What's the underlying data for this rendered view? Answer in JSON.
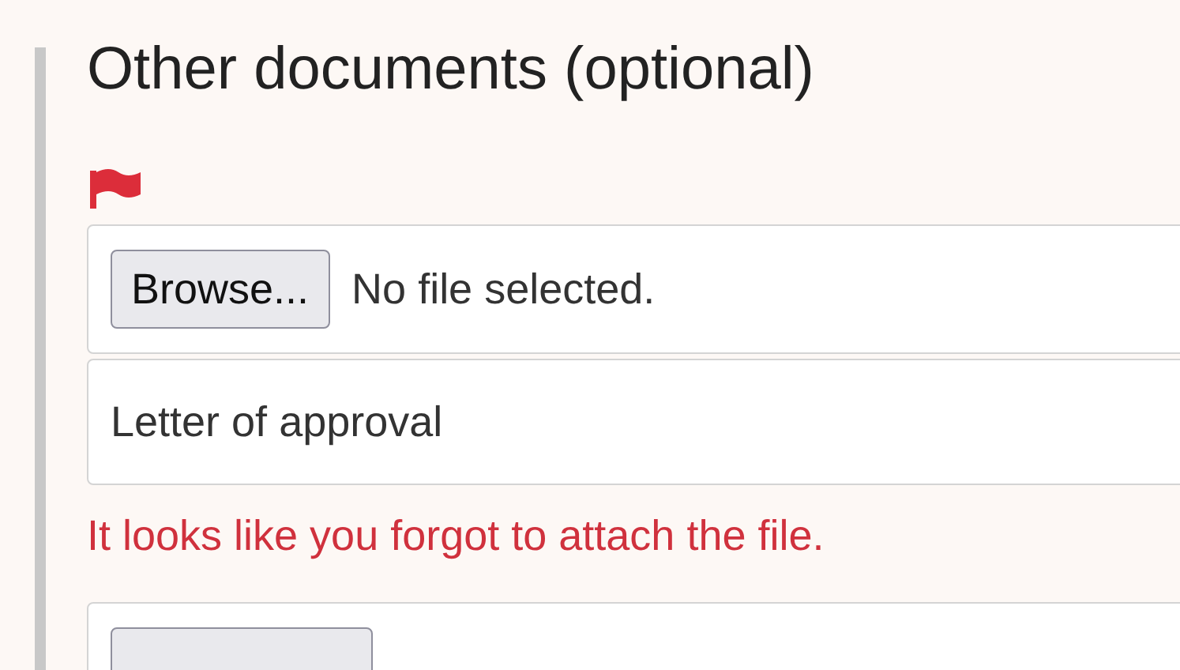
{
  "section": {
    "title": "Other documents (optional)",
    "flagged": true,
    "fields": [
      {
        "kind": "file",
        "button": "Browse...",
        "status": "No file selected."
      },
      {
        "kind": "text",
        "value": "Letter of approval"
      },
      {
        "kind": "error",
        "message": "It looks like you forgot to attach the file."
      },
      {
        "kind": "file"
      }
    ]
  }
}
